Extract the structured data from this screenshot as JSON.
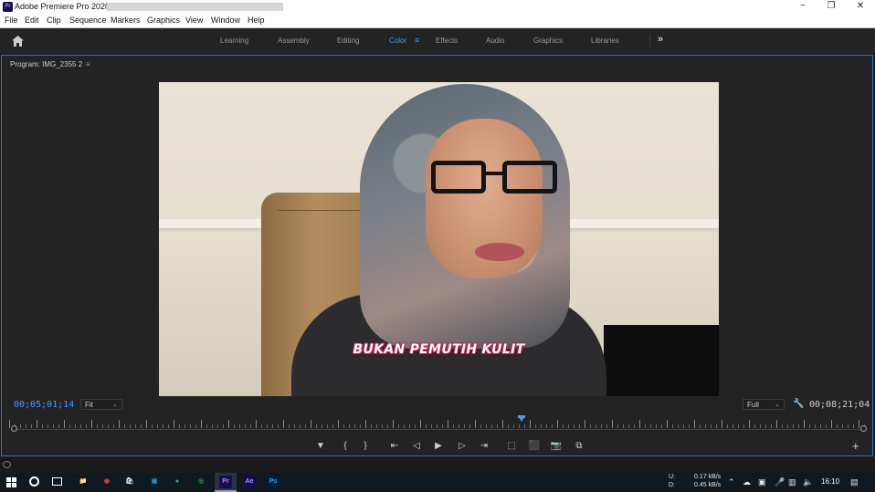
{
  "window": {
    "app_title": "Adobe Premiere Pro 2020 -",
    "app_icon_label": "Pr",
    "controls": {
      "minimize": "−",
      "maximize": "❐",
      "close": "✕"
    }
  },
  "menu": [
    "File",
    "Edit",
    "Clip",
    "Sequence",
    "Markers",
    "Graphics",
    "View",
    "Window",
    "Help"
  ],
  "workspaces": {
    "tabs": [
      "Learning",
      "Assembly",
      "Editing",
      "Color",
      "Effects",
      "Audio",
      "Graphics",
      "Libraries"
    ],
    "active": "Color",
    "menu_glyph": "≡",
    "more_glyph": "»"
  },
  "program_monitor": {
    "title": "Program: IMG_2355 2",
    "menu_glyph": "≡",
    "subtitle": "BUKAN PEMUTIH KULIT",
    "current_timecode": "00;05;01;14",
    "duration_timecode": "00;08;21;04",
    "zoom": "Fit",
    "resolution": "Full",
    "playhead_fraction": 0.598
  },
  "transport": {
    "marker": "▼",
    "mark_in": "{",
    "mark_out": "}",
    "go_to_in": "⇤",
    "step_back": "◁",
    "play": "▶",
    "step_forward": "▷",
    "go_to_out": "⇥",
    "insert": "⬚",
    "overwrite": "⬛",
    "export_frame": "📷",
    "compare": "⧉",
    "add": "+"
  },
  "taskbar": {
    "apps": [
      {
        "name": "file-explorer",
        "label": "📁",
        "color": "#e8b84a"
      },
      {
        "name": "chrome",
        "label": "◉",
        "color": "#d6453b"
      },
      {
        "name": "store",
        "label": "🛍",
        "color": "#ffffff"
      },
      {
        "name": "app-blue",
        "label": "▣",
        "color": "#2a8fd6"
      },
      {
        "name": "spotify",
        "label": "●",
        "color": "#1db954"
      },
      {
        "name": "app-green",
        "label": "◎",
        "color": "#2ea043"
      },
      {
        "name": "premiere",
        "label": "Pr",
        "color": "#9999ff"
      },
      {
        "name": "after-effects",
        "label": "Ae",
        "color": "#9999ff"
      },
      {
        "name": "photoshop",
        "label": "Ps",
        "color": "#31a8ff"
      }
    ],
    "upload_label": "U:",
    "download_label": "D:",
    "upload": "0.17 kB/s",
    "download": "0.45 kB/s",
    "time": "16:10"
  }
}
